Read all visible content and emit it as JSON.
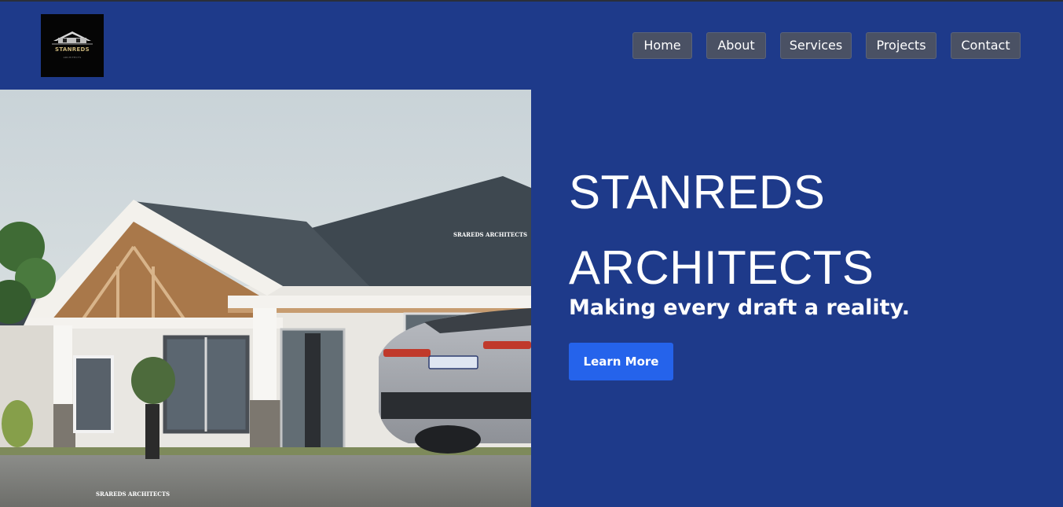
{
  "brand": {
    "logo_text": "STANREDS",
    "logo_subtext": "ARCHITECTS"
  },
  "nav": {
    "items": [
      {
        "label": "Home"
      },
      {
        "label": "About"
      },
      {
        "label": "Services"
      },
      {
        "label": "Projects"
      },
      {
        "label": "Contact"
      }
    ]
  },
  "hero": {
    "title_line1": "STANREDS",
    "title_line2": "ARCHITECTS",
    "tagline": "Making every draft a reality.",
    "cta_label": "Learn More",
    "image_watermark": "SRAREDS ARCHITECTS"
  },
  "colors": {
    "background": "#1e3a8a",
    "nav_button": "#4a5164",
    "cta": "#2563eb"
  }
}
